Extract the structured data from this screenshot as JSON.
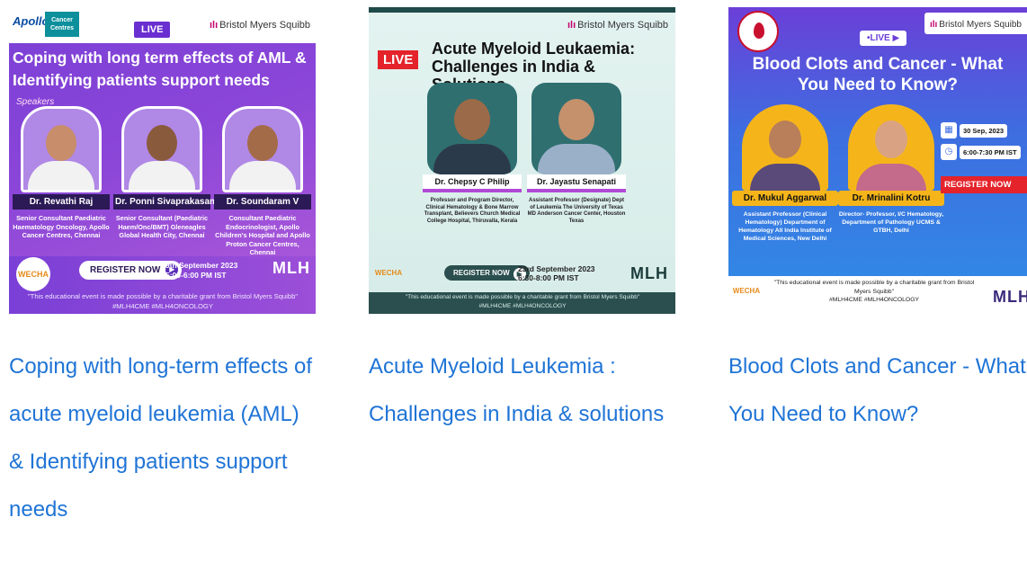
{
  "cards": [
    {
      "title": "Coping with long-term effects of acute myeloid leukemia (AML) & Identifying patients support needs",
      "thumb": {
        "apollo": "Apollo",
        "cancer_centres": "Cancer Centres",
        "live": "LIVE",
        "sponsor": "Bristol Myers Squibb",
        "headline": "Coping with long term effects of AML & Identifying patients support needs",
        "speakers_label": "Speakers",
        "speakers": [
          {
            "name": "Dr. Revathi Raj",
            "desc": "Senior Consultant Paediatric Haematology Oncology, Apollo Cancer Centres, Chennai"
          },
          {
            "name": "Dr. Ponni Sivaprakasam",
            "desc": "Senior Consultant (Paediatric Haem/Onc/BMT) Gleneagles Global Health City, Chennai"
          },
          {
            "name": "Dr. Soundaram V",
            "desc": "Consultant Paediatric Endocrinologist, Apollo Children's Hospital and Apollo Proton Cancer Centres, Chennai"
          }
        ],
        "logo": "WECHA",
        "register": "REGISTER NOW",
        "date": "9th September 2023",
        "time": "5:00-6:00 PM IST",
        "mlh": "MLH",
        "disclaimer": "\"This educational event is made possible by a charitable grant from Bristol Myers Squibb\"",
        "hashtags": "#MLH4CME   #MLH4ONCOLOGY"
      }
    },
    {
      "title": "Acute Myeloid Leukemia : Challenges in India & solutions",
      "thumb": {
        "sponsor": "Bristol Myers Squibb",
        "live": "LIVE",
        "headline": "Acute Myeloid Leukaemia: Challenges in India & Solutions",
        "speakers": [
          {
            "name": "Dr. Chepsy C Philip",
            "desc": "Professor and Program Director, Clinical Hematology & Bone Marrow Transplant, Believers Church Medical College Hospital, Thiruvalla, Kerala"
          },
          {
            "name": "Dr. Jayastu Senapati",
            "desc": "Assistant Professor (Designate) Dept of Leukemia The University of Texas MD Anderson Cancer Center, Houston Texas"
          }
        ],
        "logo": "WECHA",
        "register": "REGISTER NOW",
        "date": "23rd September 2023",
        "time": "6:30-8:00 PM IST",
        "mlh": "MLH",
        "disclaimer": "\"This educational event is made possible by a charitable grant from Bristol Myers Squibb\"",
        "hashtags": "#MLH4CME   #MLH4ONCOLOGY"
      }
    },
    {
      "title": "Blood Clots and Cancer - What You Need to Know?",
      "thumb": {
        "sponsor": "Bristol Myers Squibb",
        "live": "•LIVE ▶",
        "headline": "Blood Clots and Cancer - What You Need to Know?",
        "speakers": [
          {
            "name": "Dr. Mukul Aggarwal",
            "desc": "Assistant Professor (Clinical Hematology) Department of Hematology All India Institute of Medical Sciences, New Delhi"
          },
          {
            "name": "Dr. Mrinalini Kotru",
            "desc": "Director- Professor, I/C Hematology, Department of Pathology UCMS & GTBH, Delhi"
          }
        ],
        "date": "30 Sep, 2023",
        "time": "6:00-7:30 PM IST",
        "register": "REGISTER NOW",
        "logo": "WECHA",
        "mlh": "MLH",
        "disclaimer": "\"This educational event is made possible by a charitable grant from Bristol Myers Squibb\"",
        "hashtags": "#MLH4CME   #MLH4ONCOLOGY"
      }
    }
  ],
  "icons": {
    "sponsor": "bms-logo-icon",
    "register_arrow": "arrow-right-icon",
    "calendar": "calendar-icon",
    "clock": "clock-icon"
  }
}
